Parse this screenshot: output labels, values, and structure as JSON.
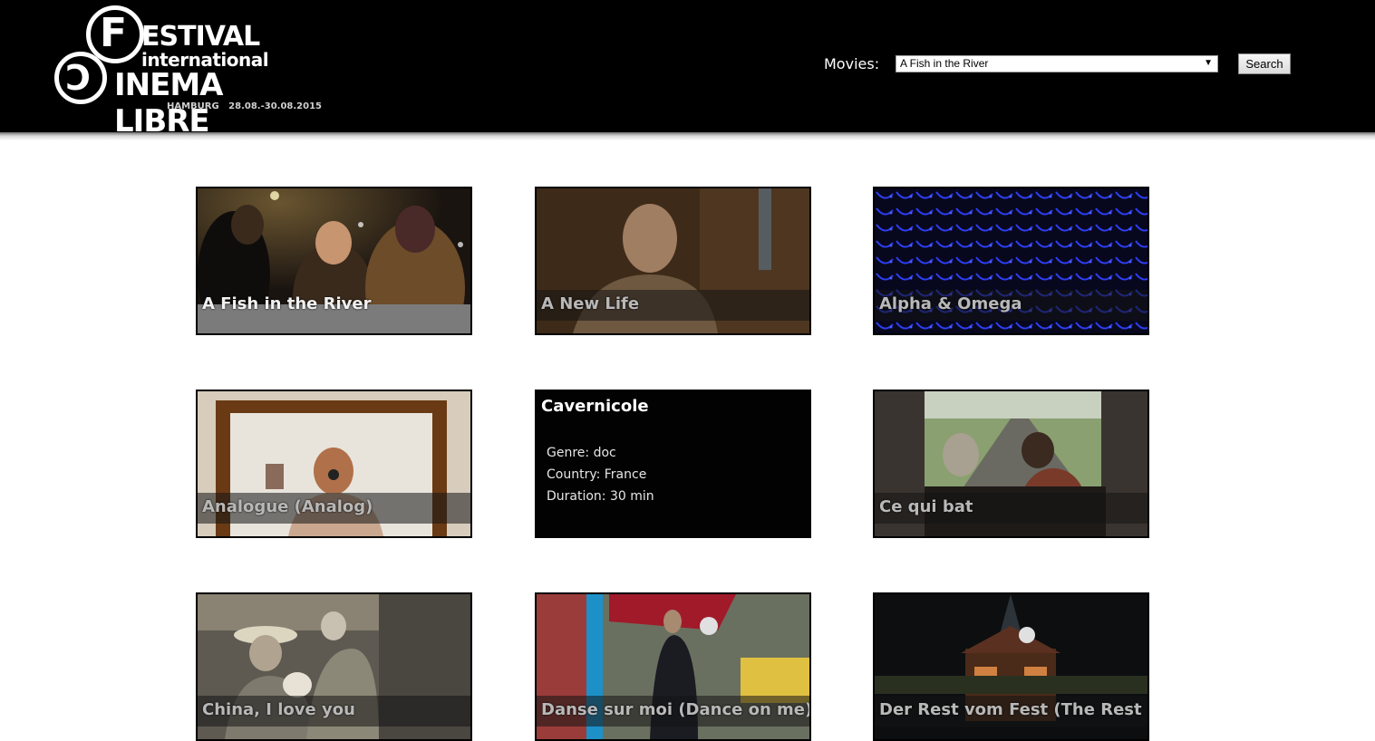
{
  "logo": {
    "letter_f": "F",
    "letter_c": "C",
    "line1": "ESTIVAL",
    "line2": "international",
    "line3": "INEMA LIBRE",
    "line4": "HAMBURG   28.08.-30.08.2015"
  },
  "search": {
    "label": "Movies:",
    "selected": "A Fish in the River",
    "button": "Search"
  },
  "movies": [
    {
      "title": "A Fish in the River"
    },
    {
      "title": "A New Life"
    },
    {
      "title": "Alpha & Omega"
    },
    {
      "title": "Analogue (Analog)"
    },
    {
      "title": "Cavernicole",
      "genre": "Genre: doc",
      "country": "Country: France",
      "duration": "Duration: 30 min"
    },
    {
      "title": "Ce qui bat"
    },
    {
      "title": "China, I love you"
    },
    {
      "title": "Danse sur moi (Dance on me)"
    },
    {
      "title": "Der Rest vom Fest (The Rest of"
    }
  ]
}
